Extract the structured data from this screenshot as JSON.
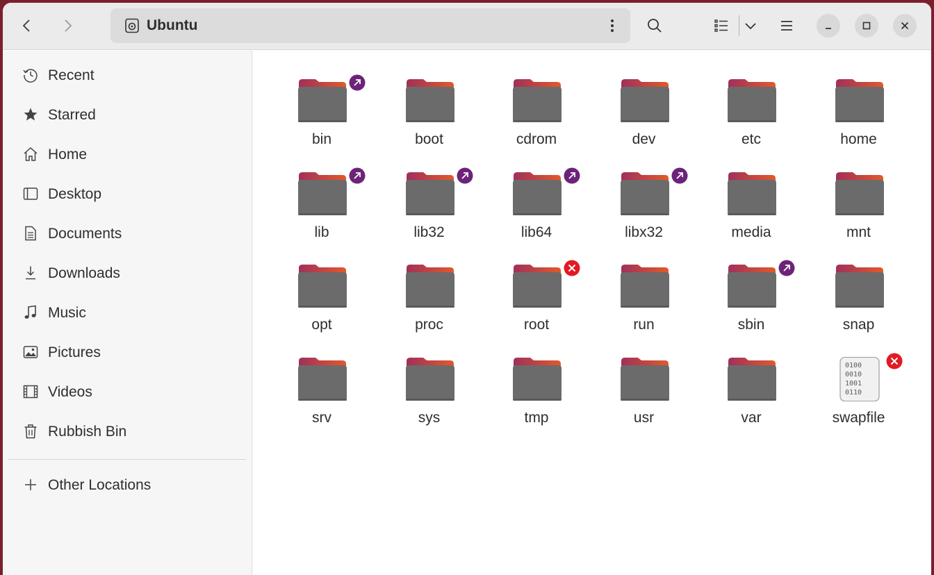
{
  "header": {
    "location": "Ubuntu",
    "back_icon": "chevron-left-icon",
    "forward_icon": "chevron-right-icon",
    "search_icon": "search-icon",
    "view_icon": "list-view-icon",
    "view_options_icon": "chevron-down-icon",
    "menu_icon": "hamburger-menu-icon",
    "minimize_icon": "minimize-icon",
    "maximize_icon": "maximize-icon",
    "close_icon": "close-icon"
  },
  "sidebar": {
    "items": [
      {
        "label": "Recent",
        "icon": "clock-icon"
      },
      {
        "label": "Starred",
        "icon": "star-icon"
      },
      {
        "label": "Home",
        "icon": "home-icon"
      },
      {
        "label": "Desktop",
        "icon": "desktop-icon"
      },
      {
        "label": "Documents",
        "icon": "document-icon"
      },
      {
        "label": "Downloads",
        "icon": "download-icon"
      },
      {
        "label": "Music",
        "icon": "music-icon"
      },
      {
        "label": "Pictures",
        "icon": "picture-icon"
      },
      {
        "label": "Videos",
        "icon": "video-icon"
      },
      {
        "label": "Rubbish Bin",
        "icon": "trash-icon"
      }
    ],
    "other": {
      "label": "Other Locations",
      "icon": "plus-icon"
    }
  },
  "files": [
    {
      "name": "bin",
      "emblem": "symlink"
    },
    {
      "name": "boot",
      "emblem": ""
    },
    {
      "name": "cdrom",
      "emblem": ""
    },
    {
      "name": "dev",
      "emblem": ""
    },
    {
      "name": "etc",
      "emblem": ""
    },
    {
      "name": "home",
      "emblem": ""
    },
    {
      "name": "lib",
      "emblem": "symlink"
    },
    {
      "name": "lib32",
      "emblem": "symlink"
    },
    {
      "name": "lib64",
      "emblem": "symlink"
    },
    {
      "name": "libx32",
      "emblem": "symlink"
    },
    {
      "name": "media",
      "emblem": ""
    },
    {
      "name": "mnt",
      "emblem": ""
    },
    {
      "name": "opt",
      "emblem": ""
    },
    {
      "name": "proc",
      "emblem": ""
    },
    {
      "name": "root",
      "emblem": "unreadable"
    },
    {
      "name": "run",
      "emblem": ""
    },
    {
      "name": "sbin",
      "emblem": "symlink"
    },
    {
      "name": "snap",
      "emblem": ""
    },
    {
      "name": "srv",
      "emblem": ""
    },
    {
      "name": "sys",
      "emblem": ""
    },
    {
      "name": "tmp",
      "emblem": ""
    },
    {
      "name": "usr",
      "emblem": ""
    },
    {
      "name": "var",
      "emblem": ""
    },
    {
      "name": "swapfile",
      "emblem": "unreadable",
      "type": "binary"
    }
  ],
  "colors": {
    "folder_tab": "#a0305a",
    "folder_tab_accent": "#e2592b",
    "folder_body": "#6b6b6b",
    "symlink_emblem": "#6d2379",
    "unreadable_emblem": "#e01b24",
    "accent": "#e95420"
  }
}
